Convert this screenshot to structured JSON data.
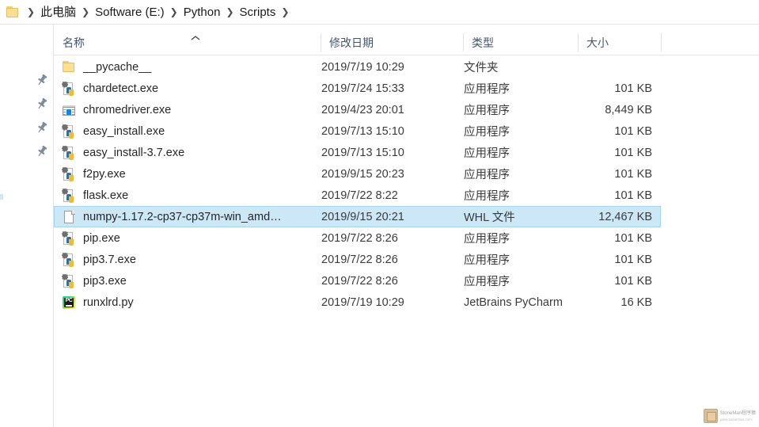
{
  "breadcrumb": {
    "folder_icon": "folder-icon",
    "separator": "chevron-right-icon",
    "crumbs": [
      "此电脑",
      "Software (E:)",
      "Python",
      "Scripts"
    ]
  },
  "nav_pane": {
    "pinned_items": [
      {
        "icon": "pin-icon"
      },
      {
        "icon": "pin-icon"
      },
      {
        "icon": "pin-icon"
      },
      {
        "icon": "pin-icon"
      }
    ]
  },
  "columns": {
    "name": "名称",
    "date_modified": "修改日期",
    "type": "类型",
    "size": "大小",
    "sort_indicator": "chevron-up-icon"
  },
  "files": [
    {
      "name": "__pycache__",
      "date": "2019/7/19 10:29",
      "type": "文件夹",
      "size": "",
      "icon": "folder-icon",
      "selected": false
    },
    {
      "name": "chardetect.exe",
      "date": "2019/7/24 15:33",
      "type": "应用程序",
      "size": "101 KB",
      "icon": "python-exe-icon",
      "selected": false
    },
    {
      "name": "chromedriver.exe",
      "date": "2019/4/23 20:01",
      "type": "应用程序",
      "size": "8,449 KB",
      "icon": "application-window-icon",
      "selected": false
    },
    {
      "name": "easy_install.exe",
      "date": "2019/7/13 15:10",
      "type": "应用程序",
      "size": "101 KB",
      "icon": "python-exe-icon",
      "selected": false
    },
    {
      "name": "easy_install-3.7.exe",
      "date": "2019/7/13 15:10",
      "type": "应用程序",
      "size": "101 KB",
      "icon": "python-exe-icon",
      "selected": false
    },
    {
      "name": "f2py.exe",
      "date": "2019/9/15 20:23",
      "type": "应用程序",
      "size": "101 KB",
      "icon": "python-exe-icon",
      "selected": false
    },
    {
      "name": "flask.exe",
      "date": "2019/7/22 8:22",
      "type": "应用程序",
      "size": "101 KB",
      "icon": "python-exe-icon",
      "selected": false
    },
    {
      "name": "numpy-1.17.2-cp37-cp37m-win_amd…",
      "date": "2019/9/15 20:21",
      "type": "WHL 文件",
      "size": "12,467 KB",
      "icon": "blank-document-icon",
      "selected": true
    },
    {
      "name": "pip.exe",
      "date": "2019/7/22 8:26",
      "type": "应用程序",
      "size": "101 KB",
      "icon": "python-exe-icon",
      "selected": false
    },
    {
      "name": "pip3.7.exe",
      "date": "2019/7/22 8:26",
      "type": "应用程序",
      "size": "101 KB",
      "icon": "python-exe-icon",
      "selected": false
    },
    {
      "name": "pip3.exe",
      "date": "2019/7/22 8:26",
      "type": "应用程序",
      "size": "101 KB",
      "icon": "python-exe-icon",
      "selected": false
    },
    {
      "name": "runxlrd.py",
      "date": "2019/7/19 10:29",
      "type": "JetBrains PyCharm",
      "size": "16 KB",
      "icon": "pycharm-icon",
      "selected": false
    }
  ],
  "watermark": {
    "line1": "StoneMan程序猿",
    "line2": "www.stoneman.com"
  },
  "colors": {
    "selection_bg": "#cce8f7",
    "selection_border": "#a5d4ee",
    "header_text": "#42566e",
    "row_text": "#262626",
    "folder_yellow": "#fcdf93"
  }
}
